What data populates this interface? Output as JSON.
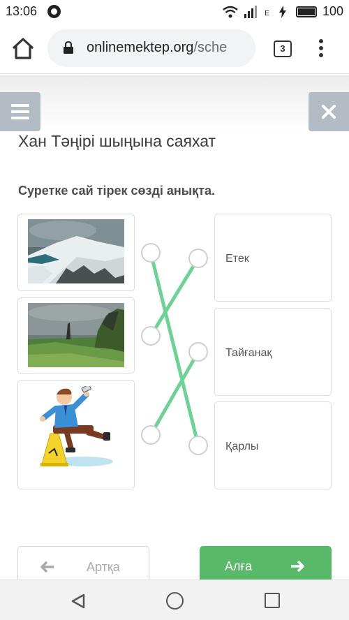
{
  "status_bar": {
    "time": "13:06",
    "network_type": "E",
    "battery": "100",
    "icons": [
      "whatsapp-icon",
      "wifi-icon",
      "signal-icon",
      "charging-icon",
      "battery-icon"
    ]
  },
  "browser": {
    "url_host": "onlinemektep.org",
    "url_rest": "/sche",
    "tab_count": "3",
    "icons": [
      "home-icon",
      "lock-icon",
      "menu-dots-icon"
    ]
  },
  "lesson": {
    "title": "Хан Тәңірі шыңына саяхат",
    "prompt": "Суретке сай тірек сөзді анықта."
  },
  "matching": {
    "images": [
      {
        "subject": "snowy-mountain-slope"
      },
      {
        "subject": "green-hills-rock-pinnacle"
      },
      {
        "subject": "man-slipping-wet-floor"
      }
    ],
    "words": [
      {
        "label": "Етек"
      },
      {
        "label": "Тайғанақ"
      },
      {
        "label": "Қарлы"
      }
    ],
    "connections": [
      {
        "image": 1,
        "word": 3
      },
      {
        "image": 2,
        "word": 1
      },
      {
        "image": 3,
        "word": 2
      }
    ],
    "line_color": "#6bd394"
  },
  "buttons": {
    "back": "Артқа",
    "next": "Алға"
  },
  "colors": {
    "accent": "#58b968",
    "side_buttons": "#b3bcc5"
  }
}
